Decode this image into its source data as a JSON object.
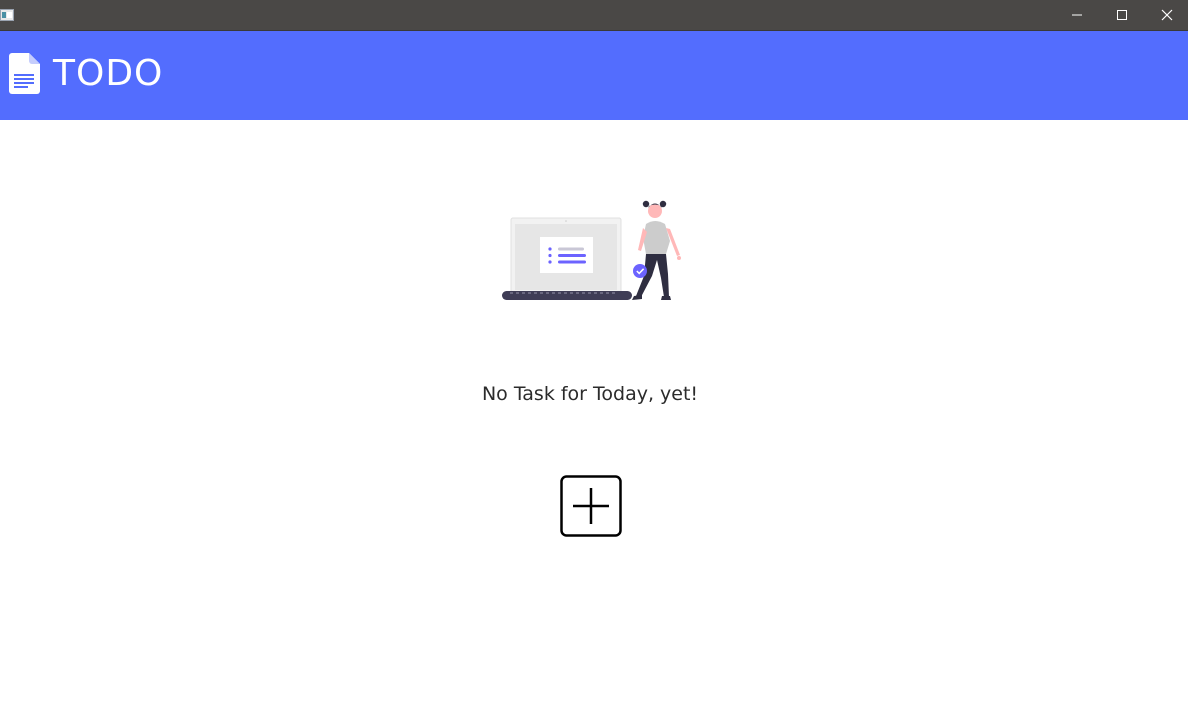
{
  "titlebar": {
    "title": "",
    "buttons": [
      {
        "name": "minimize",
        "icon": "minimize-icon"
      },
      {
        "name": "maximize",
        "icon": "maximize-icon"
      },
      {
        "name": "close",
        "icon": "close-icon"
      }
    ],
    "background": "#4a4846"
  },
  "header": {
    "title": "TODO",
    "icon": "document-icon",
    "background": "#536dfe"
  },
  "main": {
    "illustration": "empty-tasks-illustration",
    "empty_message": "No Task for Today, yet!",
    "add_button_icon": "plus-icon"
  },
  "colors": {
    "accent": "#536dfe",
    "illustration_purple": "#6c63ff",
    "text": "#2b2b2b"
  }
}
